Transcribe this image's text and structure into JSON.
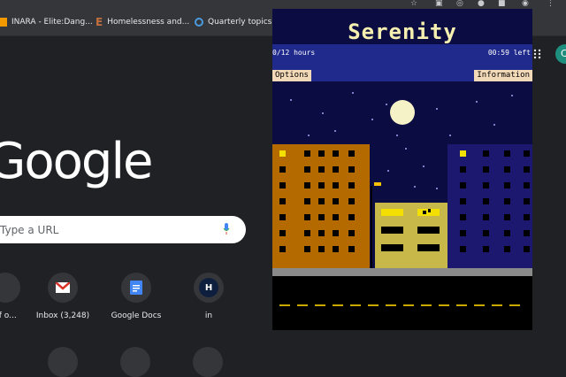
{
  "bookmarks": [
    {
      "label": "INARA - Elite:Dang...",
      "color": "#f29900"
    },
    {
      "label": "Homelessness and...",
      "color": "#c2703d"
    },
    {
      "label": "Quarterly topics -",
      "color": "#4a9be0"
    }
  ],
  "google": {
    "logo": "Google",
    "search_placeholder": "Type a URL",
    "shortcuts": [
      {
        "label": "of o...",
        "letter": ""
      },
      {
        "label": "Inbox (3,248)",
        "letter": "M"
      },
      {
        "label": "Google Docs",
        "letter": ""
      },
      {
        "label": "in",
        "letter": "H"
      }
    ]
  },
  "profile": {
    "initial": "C"
  },
  "extension": {
    "title": "Serenity",
    "progress": "0/12 hours",
    "time_left": "00:59 left",
    "options_label": "Options",
    "information_label": "Information"
  },
  "colors": {
    "sky": "#0b0d42",
    "title_bg": "#1f2a8c",
    "left_building": "#b56a00",
    "mid_building": "#c8b84a",
    "right_building": "#1c1870",
    "moon": "#f6f2c8",
    "window_lit": "#f4e000"
  }
}
